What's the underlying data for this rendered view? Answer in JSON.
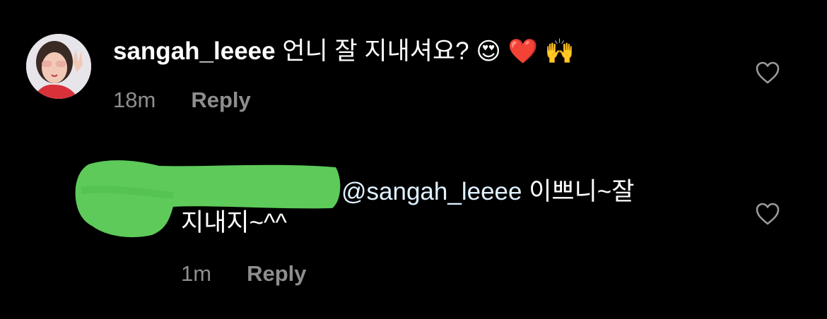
{
  "comment": {
    "username": "sangah_leeee",
    "text": "언니 잘 지내셔요?",
    "emojis": [
      "😍",
      "❤️",
      "🙌"
    ],
    "time": "18m",
    "reply_label": "Reply",
    "like_icon": "heart-outline-icon"
  },
  "reply": {
    "mention": "@sangah_leeee",
    "text_line1": "이쁘니~잘",
    "text_line2": "지내지~^^",
    "time": "1m",
    "reply_label": "Reply",
    "like_icon": "heart-outline-icon"
  },
  "colors": {
    "background": "#000000",
    "secondary_text": "#8e8e8e",
    "redaction_green": "#5dca5a",
    "mention": "#e0f1ff"
  }
}
